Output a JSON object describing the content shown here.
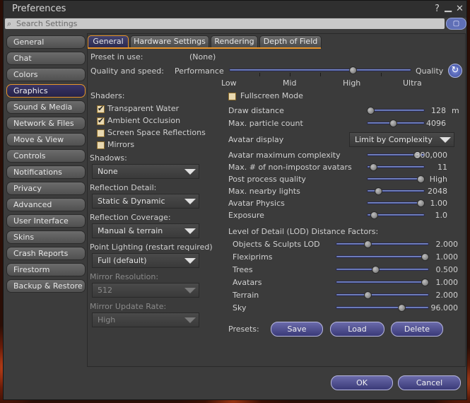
{
  "window": {
    "title": "Preferences",
    "help": "?",
    "minimize": "▁",
    "close": "✕"
  },
  "search": {
    "placeholder": "Search Settings",
    "icon": "magnifier-icon",
    "button": "▢"
  },
  "sidebar": {
    "items": [
      {
        "label": "General"
      },
      {
        "label": "Chat"
      },
      {
        "label": "Colors"
      },
      {
        "label": "Graphics",
        "selected": true
      },
      {
        "label": "Sound & Media"
      },
      {
        "label": "Network & Files"
      },
      {
        "label": "Move & View"
      },
      {
        "label": "Controls"
      },
      {
        "label": "Notifications"
      },
      {
        "label": "Privacy"
      },
      {
        "label": "Advanced"
      },
      {
        "label": "User Interface"
      },
      {
        "label": "Skins"
      },
      {
        "label": "Crash Reports"
      },
      {
        "label": "Firestorm"
      },
      {
        "label": "Backup & Restore"
      }
    ]
  },
  "tabs": [
    {
      "label": "General",
      "selected": true
    },
    {
      "label": "Hardware Settings"
    },
    {
      "label": "Rendering"
    },
    {
      "label": "Depth of Field"
    }
  ],
  "general": {
    "preset_label": "Preset in use:",
    "preset_value": "(None)",
    "quality_label": "Quality and speed:",
    "perf": "Performance",
    "quality": "Quality",
    "quality_level": 3,
    "ticks": {
      "low": "Low",
      "mid": "Mid",
      "high": "High",
      "ultra": "Ultra"
    },
    "shaders_label": "Shaders:",
    "shaders": [
      {
        "label": "Transparent Water",
        "checked": true
      },
      {
        "label": "Ambient Occlusion",
        "checked": true
      },
      {
        "label": "Screen Space Reflections",
        "checked": false
      },
      {
        "label": "Mirrors",
        "checked": false
      }
    ],
    "shadows_label": "Shadows:",
    "shadows_value": "None",
    "refl_detail_label": "Reflection Detail:",
    "refl_detail_value": "Static & Dynamic",
    "refl_cov_label": "Reflection Coverage:",
    "refl_cov_value": "Manual & terrain",
    "point_label": "Point Lighting (restart required)",
    "point_value": "Full (default)",
    "mirror_res_label": "Mirror Resolution:",
    "mirror_res_value": "512",
    "mirror_rate_label": "Mirror Update Rate:",
    "mirror_rate_value": "High",
    "fullscreen_label": "Fullscreen Mode",
    "fullscreen_checked": false,
    "right": [
      {
        "label": "Draw distance",
        "value": "128",
        "unit": "m",
        "pos": 0.0
      },
      {
        "label": "Max. particle count",
        "value": "4096",
        "pos": 0.45
      }
    ],
    "avatar_display_label": "Avatar display",
    "avatar_display_value": "Limit by Complexity",
    "right2": [
      {
        "label": "Avatar maximum complexity",
        "value": "300,000",
        "pos": 0.93
      },
      {
        "label": "Max. # of non-impostor avatars",
        "value": "11",
        "pos": 0.06
      },
      {
        "label": "Post process quality",
        "value": "High",
        "pos": 1.0
      },
      {
        "label": "Max. nearby lights",
        "value": "2048",
        "pos": 0.15
      },
      {
        "label": "Avatar Physics",
        "value": "1.00",
        "pos": 1.0
      },
      {
        "label": "Exposure",
        "value": "1.0",
        "pos": 0.07
      }
    ],
    "lod_label": "Level of Detail (LOD) Distance Factors:",
    "lod": [
      {
        "label": "Objects & Sculpts LOD",
        "value": "2.000",
        "pos": 0.33
      },
      {
        "label": "Flexiprims",
        "value": "1.000",
        "pos": 1.0
      },
      {
        "label": "Trees",
        "value": "0.500",
        "pos": 0.42
      },
      {
        "label": "Avatars",
        "value": "1.000",
        "pos": 1.0
      },
      {
        "label": "Terrain",
        "value": "2.000",
        "pos": 0.33
      },
      {
        "label": "Sky",
        "value": "96.000",
        "pos": 0.73
      }
    ],
    "presets_label": "Presets:",
    "save": "Save",
    "load": "Load",
    "delete": "Delete"
  },
  "ok": "OK",
  "cancel": "Cancel"
}
